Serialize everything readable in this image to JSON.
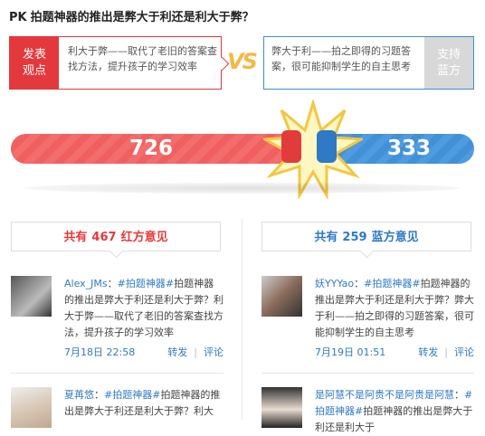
{
  "header": {
    "pk": "PK",
    "question": "拍题神器的推出是弊大于利还是利大于弊？"
  },
  "red_side": {
    "badge": "发表\n观点",
    "argument": "利大于弊——取代了老旧的答案查找方法，提升孩子的学习效率",
    "score": "726"
  },
  "blue_side": {
    "badge": "支持\n蓝方",
    "argument": "弊大于利——拍之即得的习题答案，很可能抑制学生的自主思考",
    "score": "333"
  },
  "vs": "VS",
  "tabs": {
    "red": {
      "prefix": "共有",
      "count": "467",
      "suffix": "红方意见"
    },
    "blue": {
      "prefix": "共有",
      "count": "259",
      "suffix": "蓝方意见"
    }
  },
  "red_posts": [
    {
      "user": "Alex_JMs",
      "colon": "：",
      "topic": "#拍题神器#",
      "text": "拍题神器的推出是弊大于利还是利大于弊？利大于弊——取代了老旧的答案查找方法，提升孩子的学习效率",
      "time": "7月18日 22:58",
      "forward": "转发",
      "comment": "评论"
    },
    {
      "user": "夏苒悠",
      "colon": "：",
      "topic": "#拍题神器#",
      "text": "拍题神器的推出是弊大于利还是利大于弊？利大"
    }
  ],
  "blue_posts": [
    {
      "user": "妖YYYao",
      "colon": "：",
      "topic": "#拍题神器#",
      "text": "拍题神器的推出是弊大于利还是利大于弊？弊大于利——拍之即得的习题答案，很可能抑制学生的自主思考",
      "time": "7月19日 01:51",
      "forward": "转发",
      "comment": "评论"
    },
    {
      "user": "是阿慧不是阿贵不是阿贵是阿慧",
      "colon": "：",
      "topic": "#拍题神器#",
      "text": "拍题神器的推出是弊大于利还是利大于"
    }
  ],
  "colors": {
    "red": "#e4393c",
    "blue": "#2f79c5",
    "vs": "#f4b943"
  }
}
